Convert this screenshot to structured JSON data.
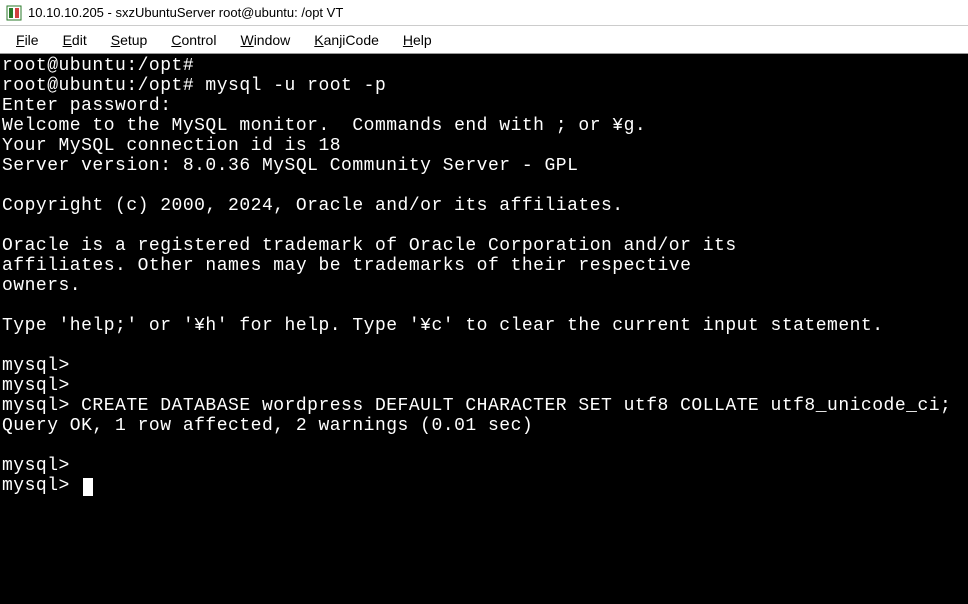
{
  "window": {
    "title": "10.10.10.205 - sxzUbuntuServer root@ubuntu: /opt VT"
  },
  "menu": {
    "file": "File",
    "edit": "Edit",
    "setup": "Setup",
    "control": "Control",
    "window": "Window",
    "kanjicode": "KanjiCode",
    "help": "Help"
  },
  "terminal": {
    "line1": "root@ubuntu:/opt#",
    "line2": "root@ubuntu:/opt# mysql -u root -p",
    "line3": "Enter password:",
    "line4": "Welcome to the MySQL monitor.  Commands end with ; or ¥g.",
    "line5": "Your MySQL connection id is 18",
    "line6": "Server version: 8.0.36 MySQL Community Server - GPL",
    "line7": "",
    "line8": "Copyright (c) 2000, 2024, Oracle and/or its affiliates.",
    "line9": "",
    "line10": "Oracle is a registered trademark of Oracle Corporation and/or its",
    "line11": "affiliates. Other names may be trademarks of their respective",
    "line12": "owners.",
    "line13": "",
    "line14": "Type 'help;' or '¥h' for help. Type '¥c' to clear the current input statement.",
    "line15": "",
    "line16": "mysql>",
    "line17": "mysql>",
    "line18": "mysql> CREATE DATABASE wordpress DEFAULT CHARACTER SET utf8 COLLATE utf8_unicode_ci;",
    "line19": "Query OK, 1 row affected, 2 warnings (0.01 sec)",
    "line20": "",
    "line21": "mysql>",
    "line22": "mysql> "
  }
}
